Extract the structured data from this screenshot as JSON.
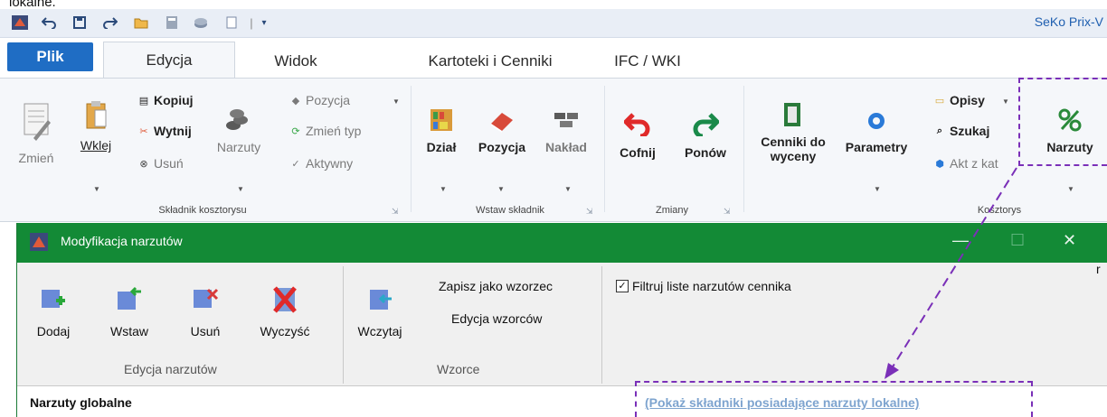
{
  "caption": "lokalne.",
  "app_title": "SeKo Prix-V",
  "qat_icons": [
    "app-icon",
    "undo-icon",
    "save-icon",
    "redo-icon",
    "folder-icon",
    "calculator-icon",
    "coins-icon",
    "page-icon",
    "dropdown-icon"
  ],
  "tabs": {
    "plik": "Plik",
    "items": [
      "Edycja",
      "Widok",
      "Kartoteki i Cenniki",
      "IFC / WKI"
    ],
    "active": "Edycja"
  },
  "ribbon": {
    "groups": {
      "skladnik": {
        "label": "Składnik kosztorysu",
        "zmien": "Zmień",
        "wklej": "Wklej",
        "kopiuj": "Kopiuj",
        "wytnij": "Wytnij",
        "usun": "Usuń",
        "narzuty": "Narzuty",
        "pozycja": "Pozycja",
        "zmien_typ": "Zmień typ",
        "aktywny": "Aktywny"
      },
      "wstaw": {
        "label": "Wstaw składnik",
        "dzial": "Dział",
        "pozycja": "Pozycja",
        "naklad": "Nakład"
      },
      "zmiany": {
        "label": "Zmiany",
        "cofnij": "Cofnij",
        "ponow": "Ponów"
      },
      "kosztorys": {
        "label": "Kosztorys",
        "cenniki_line1": "Cenniki do",
        "cenniki_line2": "wyceny",
        "parametry": "Parametry",
        "opisy": "Opisy",
        "szukaj": "Szukaj",
        "akt": "Akt z kat",
        "narzuty": "Narzuty"
      }
    }
  },
  "dialog": {
    "title": "Modyfikacja narzutów",
    "edycja_group": {
      "label": "Edycja narzutów",
      "dodaj": "Dodaj",
      "wstaw": "Wstaw",
      "usun": "Usuń",
      "wyczysc": "Wyczyść"
    },
    "wzorce_group": {
      "label": "Wzorce",
      "wczytaj": "Wczytaj",
      "zapisz": "Zapisz jako wzorzec",
      "edycja_wzorcow": "Edycja wzorców"
    },
    "filter_checkbox": {
      "label": "Filtruj liste narzutów cennika",
      "checked": true
    },
    "global_label": "Narzuty globalne",
    "local_link": "(Pokaż składniki posiadające narzuty lokalne)",
    "edge_char": "r"
  },
  "colors": {
    "ribbon_bg": "#f5f7fa",
    "plik_blue": "#1f6dc4",
    "dialog_green": "#138a36",
    "annotation_purple": "#7a2fb8",
    "link_blue": "#7ea4cf"
  }
}
